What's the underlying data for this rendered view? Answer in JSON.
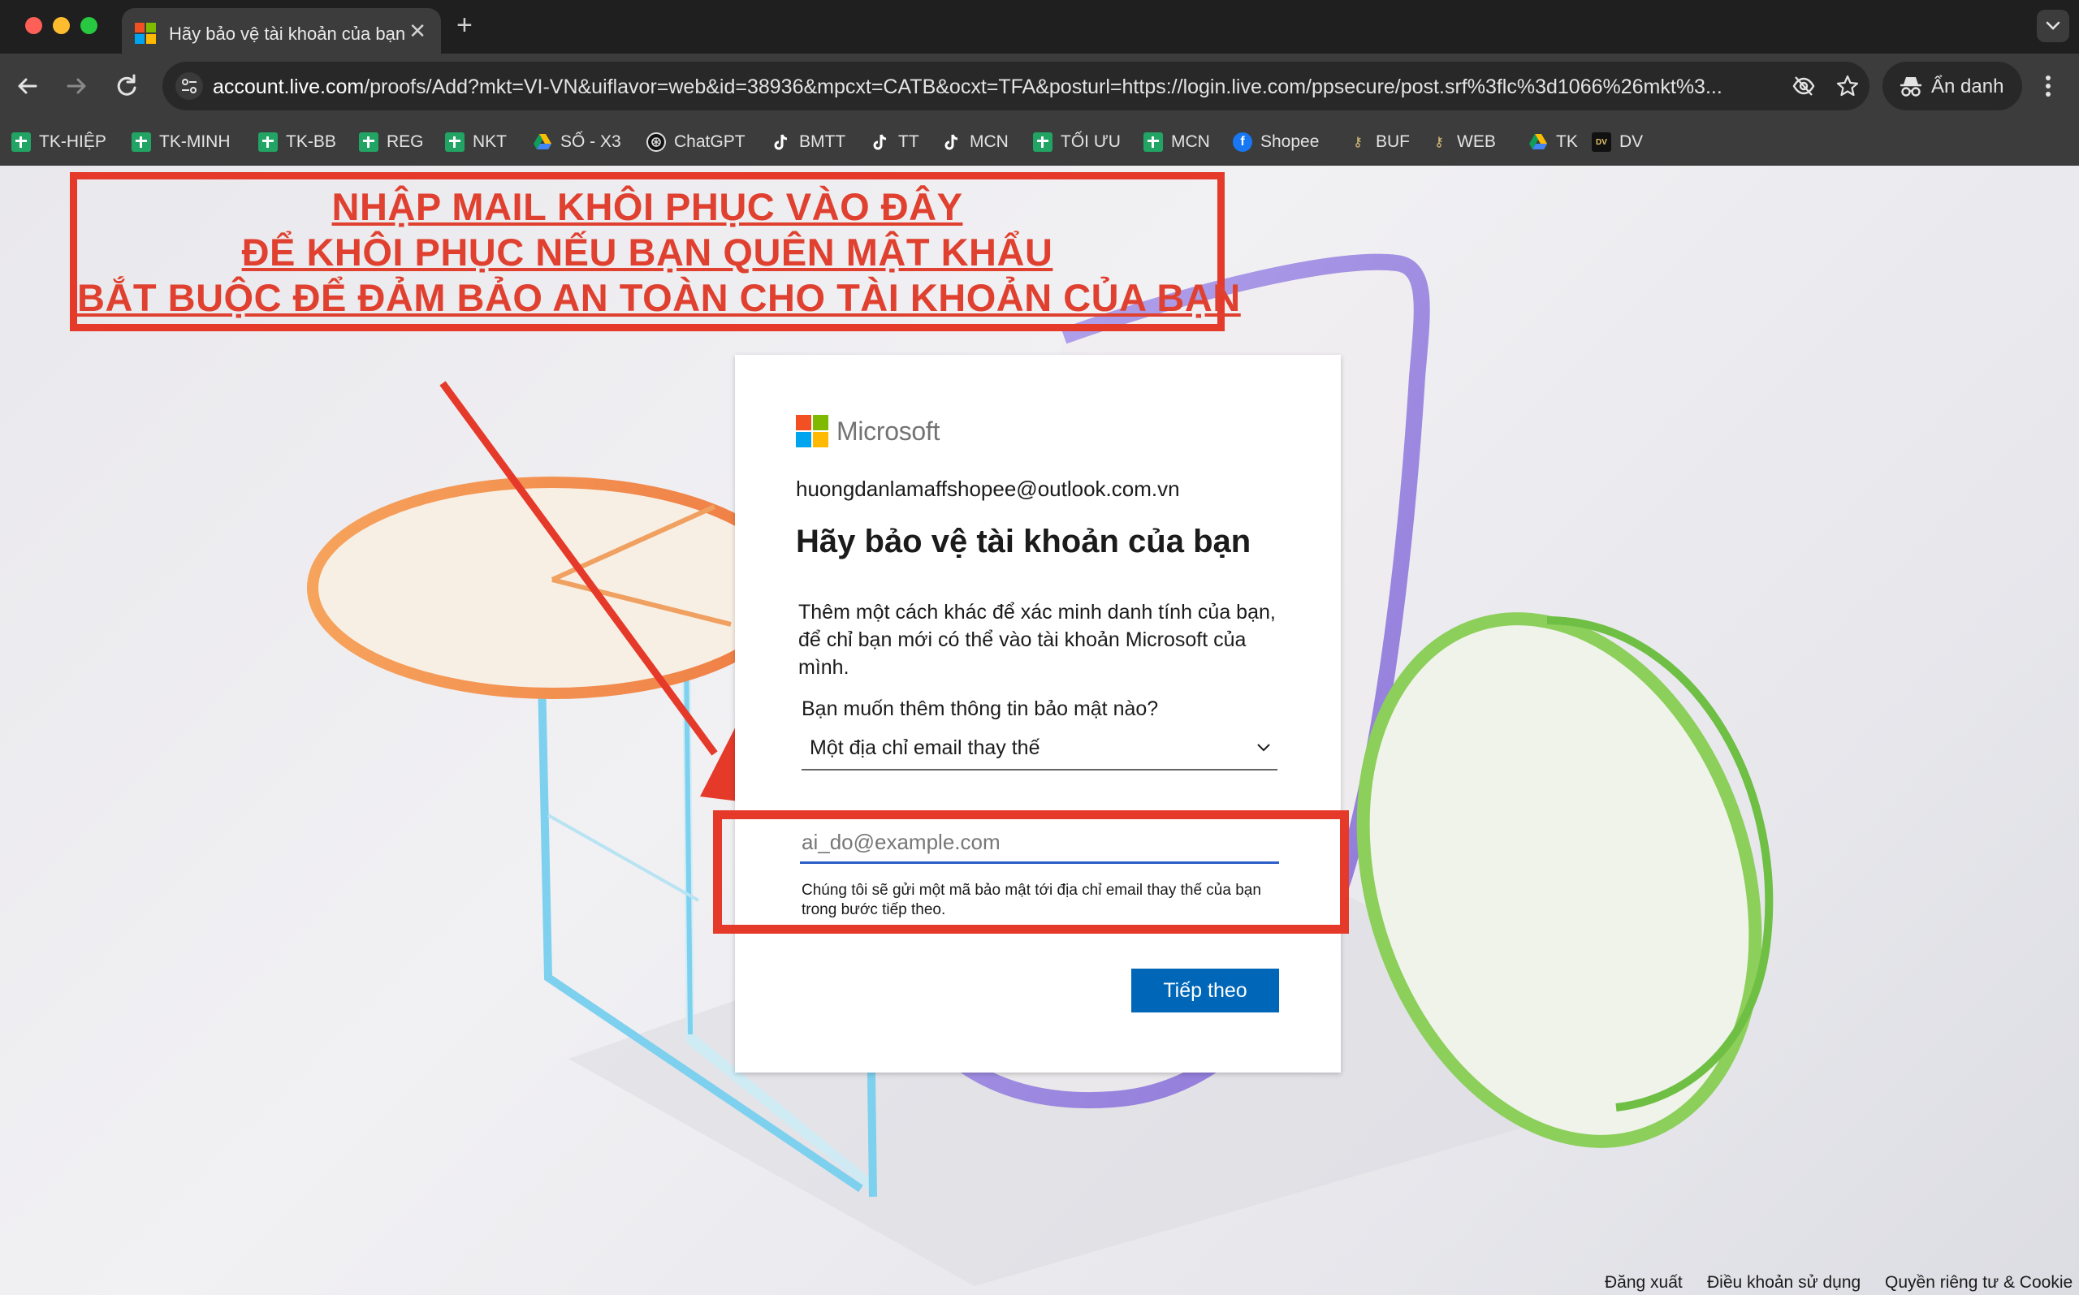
{
  "browser": {
    "tab_title": "Hãy bảo vệ tài khoản của bạn",
    "url_host": "account.live.com",
    "url_rest": "/proofs/Add?mkt=VI-VN&uiflavor=web&id=38936&mpcxt=CATB&ocxt=TFA&posturl=https://login.live.com/ppsecure/post.srf%3flc%3d1066%26mkt%3...",
    "incognito_label": "Ẩn danh",
    "bookmarks": [
      {
        "label": "TK-HIỆP",
        "icon": "sheets-icon"
      },
      {
        "label": "TK-MINH",
        "icon": "sheets-icon"
      },
      {
        "label": "TK-BB",
        "icon": "sheets-icon"
      },
      {
        "label": "REG",
        "icon": "sheets-icon"
      },
      {
        "label": "NKT",
        "icon": "sheets-icon"
      },
      {
        "label": "SỐ - X3",
        "icon": "drive-icon"
      },
      {
        "label": "ChatGPT",
        "icon": "chatgpt-icon"
      },
      {
        "label": "BMTT",
        "icon": "tiktok-icon"
      },
      {
        "label": "TT",
        "icon": "tiktok-icon"
      },
      {
        "label": "MCN",
        "icon": "tiktok-icon"
      },
      {
        "label": "TỐI ƯU",
        "icon": "sheets-icon"
      },
      {
        "label": "MCN",
        "icon": "sheets-icon"
      },
      {
        "label": "Shopee",
        "icon": "facebook-icon"
      },
      {
        "label": "BUF",
        "icon": "key-icon"
      },
      {
        "label": "WEB",
        "icon": "key-icon"
      },
      {
        "label": "TK",
        "icon": "drive-icon"
      },
      {
        "label": "DV",
        "icon": "dv-icon"
      }
    ]
  },
  "annotation": {
    "line1": "NHẬP MAIL KHÔI PHỤC VÀO ĐÂY",
    "line2": "ĐỂ KHÔI PHỤC NẾU BẠN QUÊN MẬT KHẨU",
    "line3": "BẮT BUỘC ĐỂ ĐẢM BẢO AN TOÀN CHO TÀI KHOẢN CỦA BẠN",
    "color": "#e53a2a"
  },
  "card": {
    "brand": "Microsoft",
    "account_email": "huongdanlamaffshopee@outlook.com.vn",
    "heading": "Hãy bảo vệ tài khoản của bạn",
    "description": "Thêm một cách khác để xác minh danh tính của bạn, để chỉ bạn mới có thể vào tài khoản Microsoft của mình.",
    "question": "Bạn muốn thêm thông tin bảo mật nào?",
    "selected_option": "Một địa chỉ email thay thế",
    "email_placeholder": "ai_do@example.com",
    "email_value": "",
    "hint": "Chúng tôi sẽ gửi một mã bảo mật tới địa chỉ email thay thế của bạn trong bước tiếp theo.",
    "next_button": "Tiếp theo",
    "accent_color": "#0067b8"
  },
  "footer": {
    "sign_out": "Đăng xuất",
    "terms": "Điều khoản sử dụng",
    "privacy": "Quyền riêng tư & Cookie"
  }
}
